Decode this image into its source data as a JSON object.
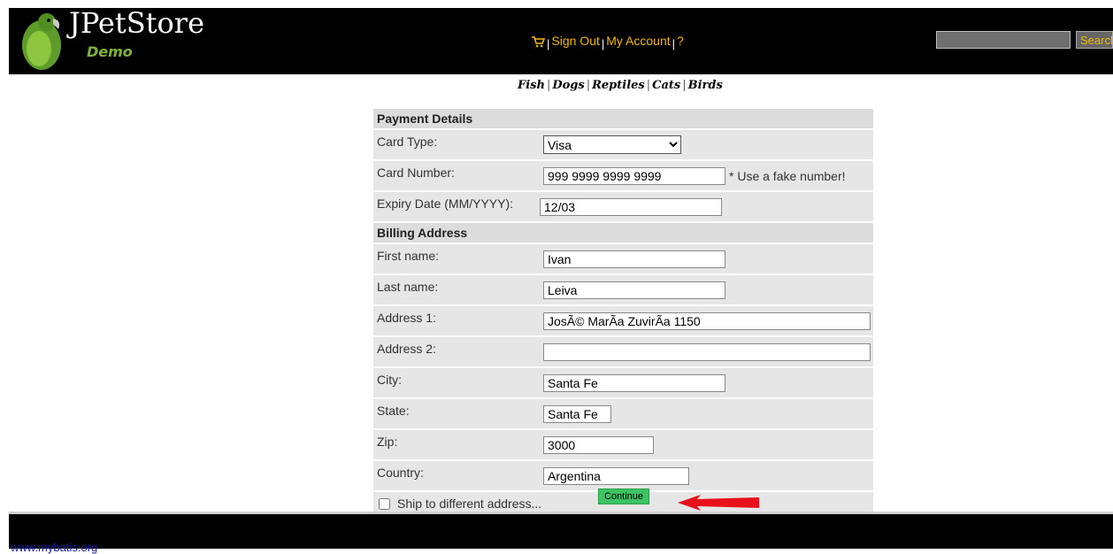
{
  "logo": {
    "title": "JPetStore",
    "subtitle": "Demo"
  },
  "menu": {
    "cart_icon": "cart-icon",
    "separator": "|",
    "sign_out": "Sign Out",
    "my_account": "My Account",
    "help": "?"
  },
  "search": {
    "value": "",
    "button": "Search"
  },
  "quicklinks": {
    "fish": "Fish",
    "dogs": "Dogs",
    "reptiles": "Reptiles",
    "cats": "Cats",
    "birds": "Birds",
    "separator": "|"
  },
  "payment": {
    "heading": "Payment Details",
    "card_type_label": "Card Type:",
    "card_type_value": "Visa",
    "card_number_label": "Card Number:",
    "card_number_value": "999 9999 9999 9999",
    "card_number_hint": "* Use a fake number!",
    "expiry_label": "Expiry Date (MM/YYYY):",
    "expiry_value": "12/03"
  },
  "billing": {
    "heading": "Billing Address",
    "first_name_label": "First name:",
    "first_name_value": "Ivan",
    "last_name_label": "Last name:",
    "last_name_value": "Leiva",
    "address1_label": "Address 1:",
    "address1_value": "JosÃ© MarÃa ZuvirÃa 1150",
    "address2_label": "Address 2:",
    "address2_value": "",
    "city_label": "City:",
    "city_value": "Santa Fe",
    "state_label": "State:",
    "state_value": "Santa Fe",
    "zip_label": "Zip:",
    "zip_value": "3000",
    "country_label": "Country:",
    "country_value": "Argentina"
  },
  "ship_different_label": "Ship to different address...",
  "ship_different_checked": false,
  "continue_label": "Continue",
  "footer_link": "www.mybatis.org",
  "colors": {
    "header_bg": "#000000",
    "menu_link": "#f2b705",
    "continue_bg": "#3ec364",
    "arrow": "#e8101a"
  }
}
